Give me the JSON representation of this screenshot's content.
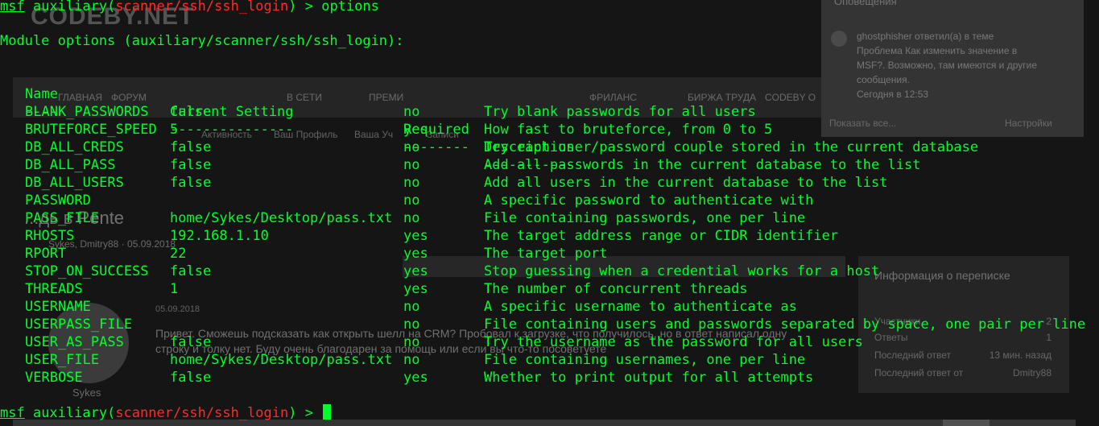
{
  "background_page": {
    "logo": "CODEBY.NET",
    "nav_items": [
      "ГЛАВНАЯ",
      "ФОРУМ",
      "В СЕТИ",
      "ПРЕМИ",
      "ФРИЛАНС",
      "БИРЖА ТРУДА",
      "CODEBY О"
    ],
    "sub_links": [
      "Активность",
      "Ваш Профиль",
      "Ваша Уч",
      "Записи"
    ],
    "thread_title": "...дь в Pente",
    "thread_meta": "Sykes, Dmitry88 · 05.09.2018",
    "post_date": "05.09.2018",
    "post_text": "Привет. Сможешь подсказать как открыть шелл на CRM? Пробовал к загрузке, что получилось, но в ответ написал одну строку и толку нет. Буду очень благодарен за помощь или если вы что-то посоветуете",
    "post_author": "Sykes",
    "notifications": {
      "title": "Оповещения",
      "text": "ghostphisher ответил(а) в теме Проблема Как изменить значение в MSF?. Возможно, там имеются и другие сообщения.",
      "time": "Сегодня в 12:53",
      "show_all": "Показать все...",
      "settings": "Настройки"
    },
    "sidebar": {
      "title": "Информация о переписке",
      "rows": [
        {
          "label": "Участники",
          "value": "2"
        },
        {
          "label": "Ответы",
          "value": "1"
        },
        {
          "label": "Последний ответ",
          "value": "13 мин. назад"
        },
        {
          "label": "Последний ответ от",
          "value": "Dmitry88"
        }
      ]
    }
  },
  "terminal": {
    "prompt_prefix": "msf",
    "prompt_module_open": " auxiliary(",
    "prompt_module_path": "scanner/ssh/ssh_login",
    "prompt_module_close": ")",
    "prompt_suffix": " > ",
    "command": "options",
    "module_options_header": "Module options (auxiliary/scanner/ssh/ssh_login):",
    "columns": {
      "name": "Name",
      "current_setting": "Current Setting",
      "required": "Required",
      "description": "Description"
    },
    "separators": {
      "name": "----",
      "current_setting": "---------------",
      "required": "--------",
      "description": "-----------"
    },
    "rows": [
      {
        "name": "BLANK_PASSWORDS",
        "setting": "false",
        "required": "no",
        "description": "Try blank passwords for all users"
      },
      {
        "name": "BRUTEFORCE_SPEED",
        "setting": "5",
        "required": "yes",
        "description": "How fast to bruteforce, from 0 to 5"
      },
      {
        "name": "DB_ALL_CREDS",
        "setting": "false",
        "required": "no",
        "description": "Try each user/password couple stored in the current database"
      },
      {
        "name": "DB_ALL_PASS",
        "setting": "false",
        "required": "no",
        "description": "Add all passwords in the current database to the list"
      },
      {
        "name": "DB_ALL_USERS",
        "setting": "false",
        "required": "no",
        "description": "Add all users in the current database to the list"
      },
      {
        "name": "PASSWORD",
        "setting": "",
        "required": "no",
        "description": "A specific password to authenticate with"
      },
      {
        "name": "PASS_FILE",
        "setting": "home/Sykes/Desktop/pass.txt",
        "required": "no",
        "description": "File containing passwords, one per line"
      },
      {
        "name": "RHOSTS",
        "setting": "192.168.1.10",
        "required": "yes",
        "description": "The target address range or CIDR identifier"
      },
      {
        "name": "RPORT",
        "setting": "22",
        "required": "yes",
        "description": "The target port"
      },
      {
        "name": "STOP_ON_SUCCESS",
        "setting": "false",
        "required": "yes",
        "description": "Stop guessing when a credential works for a host"
      },
      {
        "name": "THREADS",
        "setting": "1",
        "required": "yes",
        "description": "The number of concurrent threads"
      },
      {
        "name": "USERNAME",
        "setting": "",
        "required": "no",
        "description": "A specific username to authenticate as"
      },
      {
        "name": "USERPASS_FILE",
        "setting": "",
        "required": "no",
        "description": "File containing users and passwords separated by space, one pair per line"
      },
      {
        "name": "USER_AS_PASS",
        "setting": "false",
        "required": "no",
        "description": "Try the username as the password for all users"
      },
      {
        "name": "USER_FILE",
        "setting": "home/Sykes/Desktop/pass.txt",
        "required": "no",
        "description": "File containing usernames, one per line"
      },
      {
        "name": "VERBOSE",
        "setting": "false",
        "required": "yes",
        "description": "Whether to print output for all attempts"
      }
    ]
  },
  "colors": {
    "terminal_text": "#00ff2a",
    "module_path": "#ff2a2a",
    "terminal_bg": "#151515"
  }
}
